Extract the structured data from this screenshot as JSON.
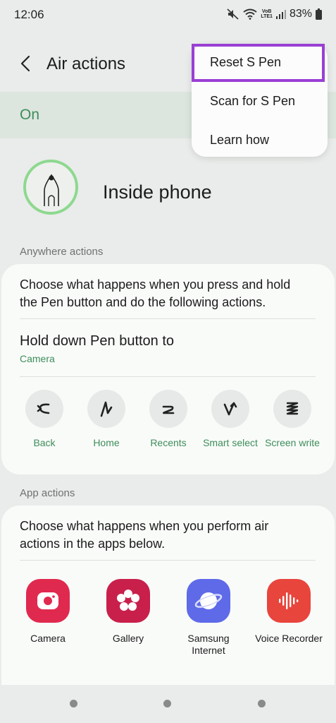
{
  "status_bar": {
    "time": "12:06",
    "volte_label": "VoB",
    "lte_label": "LTE1",
    "battery": "83%"
  },
  "header": {
    "title": "Air actions"
  },
  "master_switch": {
    "label": "On"
  },
  "pen_status": {
    "label": "Inside phone"
  },
  "anywhere_actions": {
    "section_title": "Anywhere actions",
    "description": "Choose what happens when you press and hold the Pen button and do the following actions.",
    "hold_title": "Hold down Pen button to",
    "hold_value": "Camera",
    "gestures": [
      {
        "label": "Back",
        "icon": "gesture-back-icon"
      },
      {
        "label": "Home",
        "icon": "gesture-home-icon"
      },
      {
        "label": "Recents",
        "icon": "gesture-recents-icon"
      },
      {
        "label": "Smart select",
        "icon": "gesture-smart-select-icon"
      },
      {
        "label": "Screen write",
        "icon": "gesture-screen-write-icon"
      }
    ]
  },
  "app_actions": {
    "section_title": "App actions",
    "description": "Choose what happens when you perform air actions in the apps below.",
    "apps": [
      {
        "label": "Camera",
        "color": "#e0294e"
      },
      {
        "label": "Gallery",
        "color": "#c8204b"
      },
      {
        "label": "Samsung Internet",
        "color": "#5e6ae8"
      },
      {
        "label": "Voice Recorder",
        "color": "#e8453c"
      }
    ],
    "partial_colors": [
      "#f06a3a",
      "#2aa5d8",
      "#e0294e",
      "#5e4bd6"
    ]
  },
  "menu": {
    "items": [
      "Reset S Pen",
      "Scan for S Pen",
      "Learn how"
    ],
    "highlight_color": "#9a3fd4"
  },
  "colors": {
    "accent_green": "#3e8d5a",
    "ring_green": "#8ed88f"
  }
}
